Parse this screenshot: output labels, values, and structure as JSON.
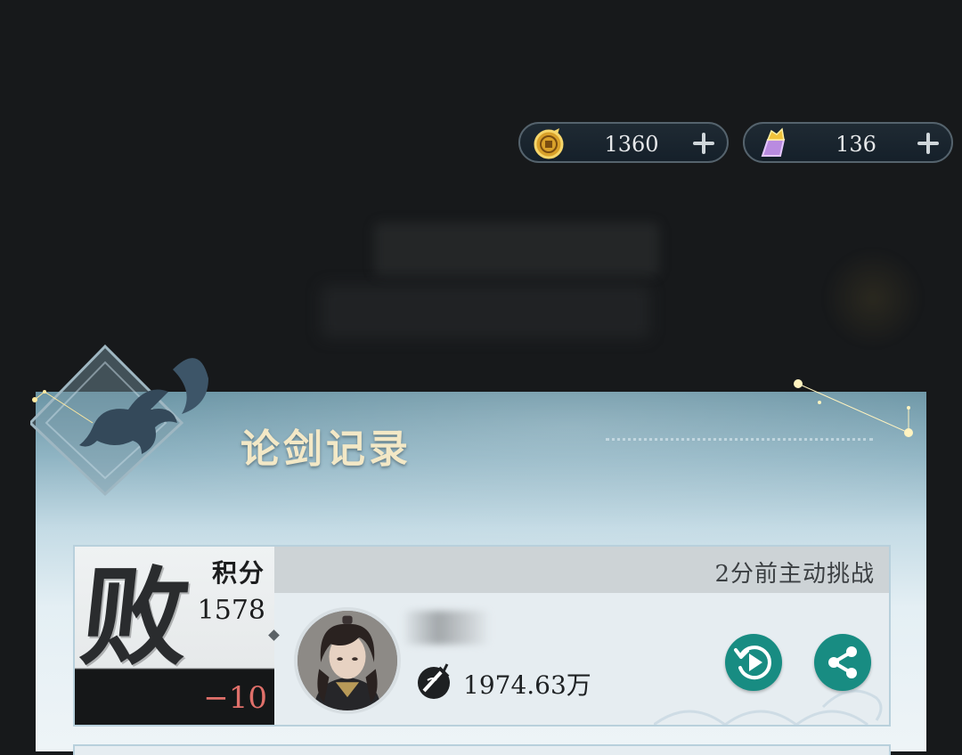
{
  "currencies": [
    {
      "name": "copper-coin",
      "value": "1360",
      "icon": "coin-icon"
    },
    {
      "name": "purple-token",
      "value": "136",
      "icon": "token-icon"
    }
  ],
  "panel": {
    "title": "论剑记录"
  },
  "record": {
    "result": "败",
    "score_label": "积分",
    "score": "1578",
    "score_delta": "−10",
    "challenge_info": "2分前主动挑战",
    "power": "1974.63万",
    "replay_icon": "replay-icon",
    "share_icon": "share-icon"
  },
  "colors": {
    "accent_teal": "#188c82",
    "loss_red": "#e0706a",
    "title_cream": "#f3e8c6"
  }
}
